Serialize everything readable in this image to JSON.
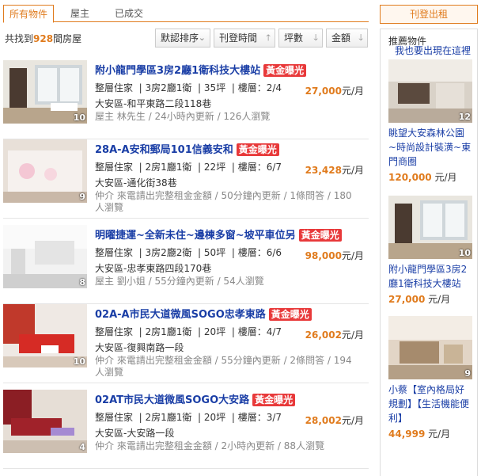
{
  "tabs": [
    "所有物件",
    "屋主",
    "已成交"
  ],
  "summary": {
    "prefix": "共找到",
    "count": "928",
    "suffix": "間房屋"
  },
  "sort": [
    {
      "label": "默認排序",
      "icon": "chevron-down"
    },
    {
      "label": "刊登時間",
      "icon": "arrow-up"
    },
    {
      "label": "坪數",
      "icon": "arrow-down"
    },
    {
      "label": "金額",
      "icon": "arrow-down"
    }
  ],
  "listings": [
    {
      "title": "附小龍門學區3房2廳1衛科技大樓站",
      "badge": "黃金曝光",
      "type": "整層住家",
      "rooms": "3房2廳1衛",
      "size": "35坪",
      "floor": "樓層：2/4",
      "addr": "大安區-和平東路二段118巷",
      "update": "屋主 林先生 / 24小時內更新 / 126人瀏覽",
      "price": "27,000",
      "unit": "元/月",
      "photos": "10"
    },
    {
      "title": "28A-A安和郵局101信義安和",
      "badge": "黃金曝光",
      "type": "整層住家",
      "rooms": "2房1廳1衛",
      "size": "22坪",
      "floor": "樓層：6/7",
      "addr": "大安區-通化街38巷",
      "update": "仲介 來電請出完整租金金額 / 50分鐘內更新 / 1條問答 / 180人瀏覽",
      "price": "23,428",
      "unit": "元/月",
      "photos": "9"
    },
    {
      "title": "明曜捷運~全新未住~邊棟多窗~坡平車位另",
      "badge": "黃金曝光",
      "type": "整層住家",
      "rooms": "3房2廳2衛",
      "size": "50坪",
      "floor": "樓層：6/6",
      "addr": "大安區-忠孝東路四段170巷",
      "update": "屋主 劉小姐 / 55分鐘內更新 / 54人瀏覽",
      "price": "98,000",
      "unit": "元/月",
      "photos": "8"
    },
    {
      "title": "02A-A市民大道微風SOGO忠孝東路",
      "badge": "黃金曝光",
      "type": "整層住家",
      "rooms": "2房1廳1衛",
      "size": "20坪",
      "floor": "樓層：4/7",
      "addr": "大安區-復興南路一段",
      "update": "仲介 來電請出完整租金金額 / 55分鐘內更新 / 2條問答 / 194人瀏覽",
      "price": "26,002",
      "unit": "元/月",
      "photos": "10"
    },
    {
      "title": "02AT市民大道微風SOGO大安路",
      "badge": "黃金曝光",
      "type": "整層住家",
      "rooms": "2房1廳1衛",
      "size": "20坪",
      "floor": "樓層：3/7",
      "addr": "大安區-大安路一段",
      "update": "仲介 來電請出完整租金金額 / 2小時內更新 / 88人瀏覽",
      "price": "28,002",
      "unit": "元/月",
      "photos": "4"
    }
  ],
  "sidebar": {
    "post_label": "刊登出租",
    "heading": "推薦物件",
    "link": "我也要出現在這裡",
    "recs": [
      {
        "title": "眺望大安森林公園~時尚設計裝潢~東門商圈",
        "price": "120,000",
        "unit": "元/月",
        "photos": "12"
      },
      {
        "title": "附小龍門學區3房2廳1衛科技大樓站",
        "price": "27,000",
        "unit": "元/月",
        "photos": "10"
      },
      {
        "title": "小蔡【室內格局好規劃】【生活機能便利】",
        "price": "44,999",
        "unit": "元/月",
        "photos": "9"
      }
    ]
  },
  "colors": {
    "accent": "#e07b1d",
    "link": "#1a3ea6",
    "badge": "#e8393a"
  }
}
